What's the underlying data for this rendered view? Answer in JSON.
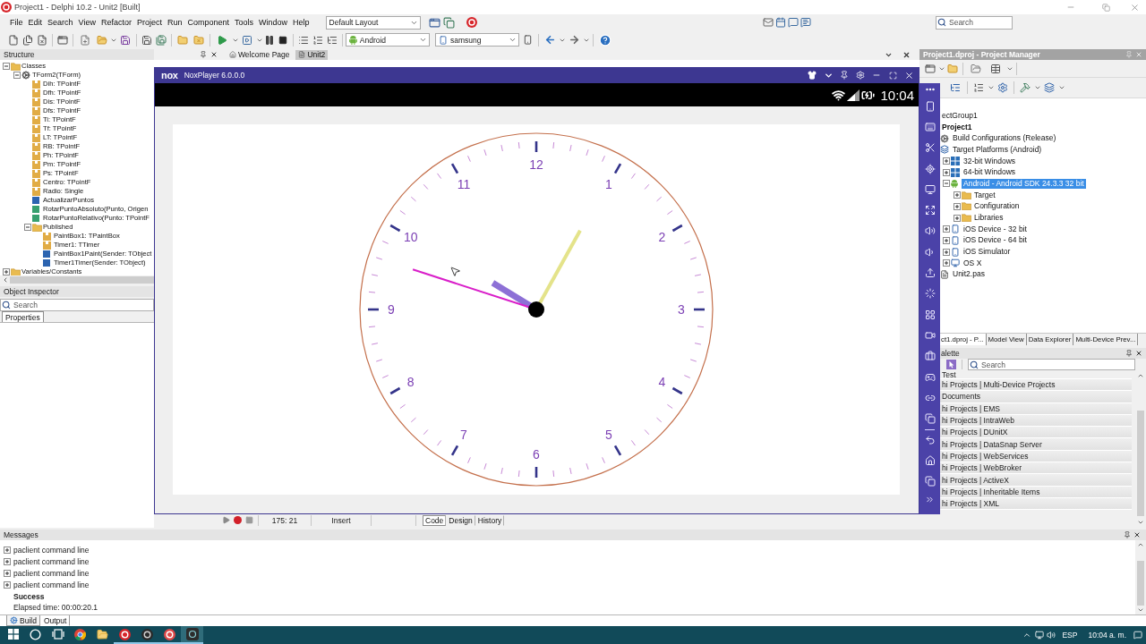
{
  "title_bar": {
    "title": "Project1 - Delphi 10.2 - Unit2 [Built]"
  },
  "menu": [
    "File",
    "Edit",
    "Search",
    "View",
    "Refactor",
    "Project",
    "Run",
    "Component",
    "Tools",
    "Window",
    "Help"
  ],
  "layout_select": {
    "value": "Default Layout"
  },
  "ide_search": {
    "placeholder": "Search"
  },
  "toolbar": {
    "platform": {
      "value": "Android"
    },
    "device": {
      "value": "samsung"
    }
  },
  "structure": {
    "title": "Structure",
    "active": false,
    "tree": [
      {
        "label": "Classes",
        "kind": "folder",
        "expanded": true,
        "children": [
          {
            "label": "TForm2(TForm)",
            "kind": "class",
            "expanded": true,
            "children": [
              {
                "label": "Dih: TPointF",
                "kind": "field"
              },
              {
                "label": "Dfh: TPointF",
                "kind": "field"
              },
              {
                "label": "Dis: TPointF",
                "kind": "field"
              },
              {
                "label": "Dfs: TPointF",
                "kind": "field"
              },
              {
                "label": "Ti: TPointF",
                "kind": "field"
              },
              {
                "label": "Tf: TPointF",
                "kind": "field"
              },
              {
                "label": "LT: TPointF",
                "kind": "field"
              },
              {
                "label": "RB: TPointF",
                "kind": "field"
              },
              {
                "label": "Ph: TPointF",
                "kind": "field"
              },
              {
                "label": "Pm: TPointF",
                "kind": "field"
              },
              {
                "label": "Ps: TPointF",
                "kind": "field"
              },
              {
                "label": "Centro: TPointF",
                "kind": "field"
              },
              {
                "label": "Radio: Single",
                "kind": "field"
              },
              {
                "label": "ActualizarPuntos",
                "kind": "procedure"
              },
              {
                "label": "RotarPuntoAbsoluto(Punto, Origen",
                "kind": "function"
              },
              {
                "label": "RotarPuntoRelativo(Punto: TPointF",
                "kind": "function"
              },
              {
                "label": "Published",
                "kind": "folder",
                "expanded": true,
                "children": [
                  {
                    "label": "PaintBox1: TPaintBox",
                    "kind": "field"
                  },
                  {
                    "label": "Timer1: TTimer",
                    "kind": "field"
                  },
                  {
                    "label": "PaintBox1Paint(Sender: TObject",
                    "kind": "procedure"
                  },
                  {
                    "label": "Timer1Timer(Sender: TObject)",
                    "kind": "procedure"
                  }
                ]
              }
            ]
          }
        ]
      },
      {
        "label": "Variables/Constants",
        "kind": "folder",
        "expanded": false
      }
    ]
  },
  "object_inspector": {
    "title": "Object Inspector",
    "active": false,
    "search": {
      "placeholder": "Search"
    },
    "tabs": [
      {
        "label": "Properties",
        "selected": true
      }
    ]
  },
  "editor": {
    "tabs": [
      {
        "label": "Welcome Page",
        "selected": false
      },
      {
        "label": "Unit2",
        "selected": true
      }
    ],
    "status": {
      "position": "175: 21",
      "mode": "Insert"
    },
    "view_tabs": [
      {
        "label": "Code",
        "selected": true
      },
      {
        "label": "Design",
        "selected": false
      },
      {
        "label": "History",
        "selected": false
      }
    ]
  },
  "emulator": {
    "logo": "nox",
    "title": "NoxPlayer 6.0.0.0",
    "status_time": "10:04",
    "dial_numbers": [
      "12",
      "1",
      "2",
      "3",
      "4",
      "5",
      "6",
      "7",
      "8",
      "9",
      "10",
      "11"
    ]
  },
  "project_manager": {
    "title": "Project1.dproj - Project Manager",
    "active": true,
    "tree": [
      {
        "label": "ectGroup1",
        "selected": false,
        "children": [
          {
            "label": "Project1",
            "kind": "project",
            "selected": false,
            "children": [
              {
                "label": "Build Configurations (Release)",
                "kind": "config",
                "selected": false
              },
              {
                "label": "Target Platforms (Android)",
                "kind": "platforms",
                "selected": false,
                "children": [
                  {
                    "label": "32-bit Windows",
                    "kind": "windows",
                    "selected": false,
                    "expanded": false
                  },
                  {
                    "label": "64-bit Windows",
                    "kind": "windows",
                    "selected": false,
                    "expanded": false
                  },
                  {
                    "label": "Android - Android SDK 24.3.3 32 bit",
                    "kind": "android",
                    "selected": true,
                    "expanded": true,
                    "children": [
                      {
                        "label": "Target",
                        "kind": "folder",
                        "selected": false,
                        "expanded": false
                      },
                      {
                        "label": "Configuration",
                        "kind": "folder",
                        "selected": false,
                        "expanded": false
                      },
                      {
                        "label": "Libraries",
                        "kind": "folder",
                        "selected": false,
                        "expanded": false
                      }
                    ]
                  },
                  {
                    "label": "iOS Device - 32 bit",
                    "kind": "device",
                    "selected": false,
                    "expanded": false
                  },
                  {
                    "label": "iOS Device - 64 bit",
                    "kind": "device",
                    "selected": false,
                    "expanded": false
                  },
                  {
                    "label": "iOS Simulator",
                    "kind": "device",
                    "selected": false,
                    "expanded": false
                  },
                  {
                    "label": "OS X",
                    "kind": "mac",
                    "selected": false,
                    "expanded": false
                  }
                ]
              },
              {
                "label": "Unit2.pas",
                "kind": "file",
                "selected": false
              }
            ]
          }
        ]
      }
    ],
    "tabs": [
      {
        "label": "ct1.dproj - P...",
        "selected": true
      },
      {
        "label": "Model View",
        "selected": false
      },
      {
        "label": "Data Explorer",
        "selected": false
      },
      {
        "label": "Multi-Device Prev...",
        "selected": false
      }
    ]
  },
  "palette": {
    "title": "alette",
    "active": false,
    "search": {
      "placeholder": "Search"
    },
    "items": [
      "Test",
      "hi Projects | Multi-Device Projects",
      "Documents",
      "hi Projects | EMS",
      "hi Projects | IntraWeb",
      "hi Projects | DUnitX",
      "hi Projects | DataSnap Server",
      "hi Projects | WebServices",
      "hi Projects | WebBroker",
      "hi Projects | ActiveX",
      "hi Projects | Inheritable Items",
      "hi Projects | XML"
    ]
  },
  "messages": {
    "title": "Messages",
    "active": false,
    "lines": [
      {
        "kind": "command",
        "text": "paclient command line",
        "expanded": false
      },
      {
        "kind": "command",
        "text": "paclient command line",
        "expanded": false
      },
      {
        "kind": "command",
        "text": "paclient command line",
        "expanded": false
      },
      {
        "kind": "command",
        "text": "paclient command line",
        "expanded": false
      },
      {
        "kind": "result",
        "text": "Success"
      },
      {
        "kind": "info",
        "text": "Elapsed time: 00:00:20.1"
      }
    ],
    "tabs": [
      {
        "label": "Build",
        "selected": true
      },
      {
        "label": "Output",
        "selected": false
      }
    ]
  },
  "taskbar": {
    "language": "ESP",
    "time": "10:04 a. m."
  }
}
